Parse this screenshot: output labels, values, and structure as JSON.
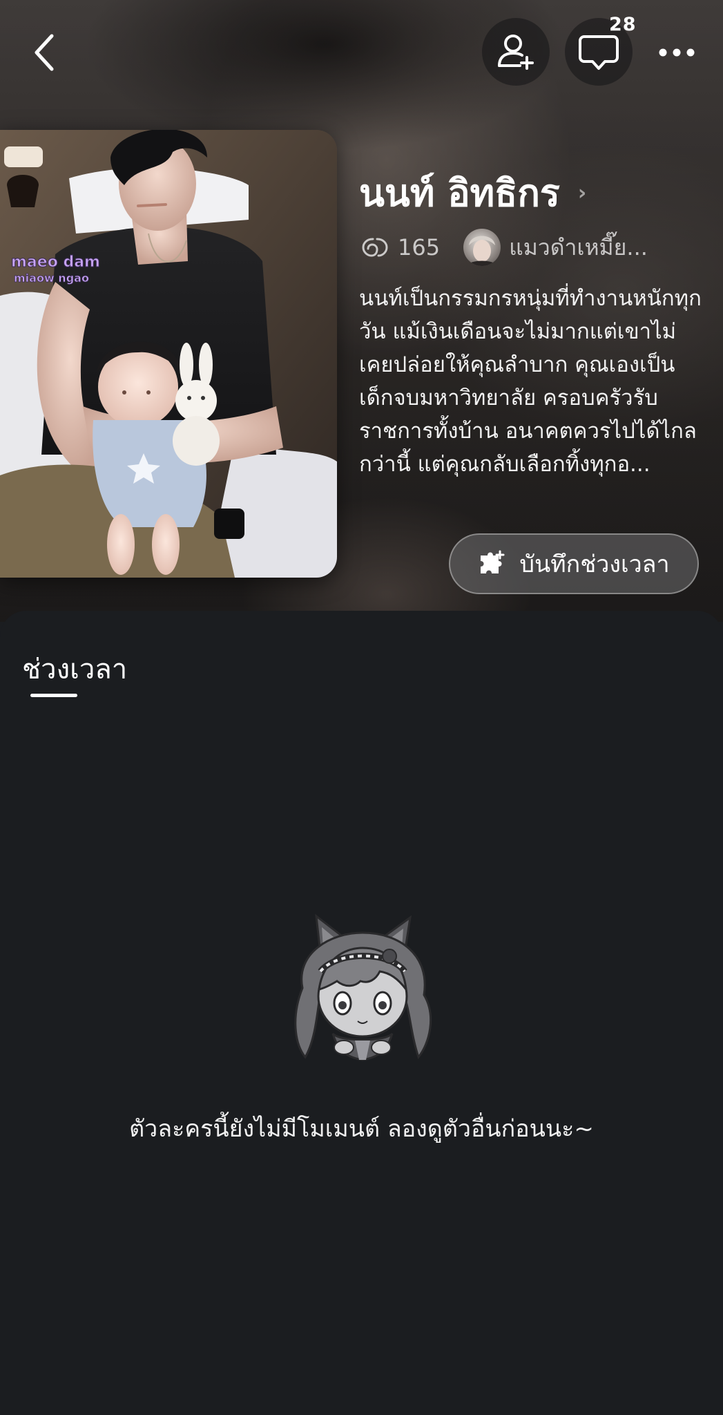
{
  "header": {
    "back_icon": "chevron-left-icon",
    "follow_icon": "add-user-icon",
    "chat_icon": "chat-bubble-icon",
    "chat_badge": "28",
    "more_icon": "more-horizontal-icon"
  },
  "character": {
    "name": "นนท์ อิทธิกร",
    "chat_count": "165",
    "creator_name": "แมวดำเหมี๊ย...",
    "description": "นนท์เป็นกรรมกรหนุ่มที่ทำงานหนักทุกวัน แม้เงินเดือนจะไม่มากแต่เขาไม่เคยปล่อยให้คุณลำบาก คุณเองเป็นเด็กจบมหาวิทยาลัย ครอบครัวรับราชการทั้งบ้าน อนาคตควรไปได้ไกลกว่านี้ แต่คุณกลับเลือกทิ้งทุกอ...",
    "cover_watermark_line1": "maeo dam",
    "cover_watermark_line2": "miaow ngao"
  },
  "actions": {
    "save_moment_label": "บันทึกช่วงเวลา",
    "save_moment_icon": "puzzle-plus-icon"
  },
  "tabs": [
    {
      "label": "ช่วงเวลา",
      "active": true
    }
  ],
  "empty_state": {
    "message": "ตัวละครนี้ยังไม่มีโมเมนต์ ลองดูตัวอื่นก่อนนะ~",
    "illustration": "chibi-catgirl-illustration"
  },
  "colors": {
    "background": "#1b1d20",
    "accent": "#ffffff"
  }
}
